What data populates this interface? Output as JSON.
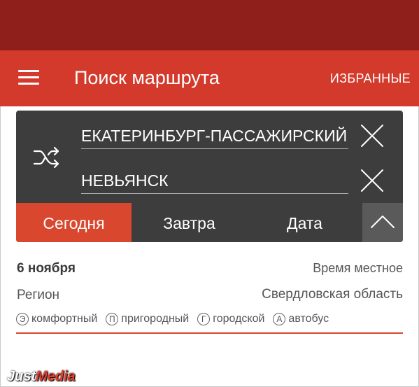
{
  "app_bar": {
    "title": "Поиск маршрута",
    "favorites_label": "ИЗБРАННЫЕ",
    "color": "#d33a2c",
    "status_color": "#8e1f1a"
  },
  "route": {
    "from": "ЕКАТЕРИНБУРГ-ПАССАЖИРСКИЙ",
    "to": "НЕВЬЯНСК"
  },
  "tabs": [
    {
      "label": "Сегодня",
      "selected": true
    },
    {
      "label": "Завтра",
      "selected": false
    },
    {
      "label": "Дата",
      "selected": false
    }
  ],
  "info": {
    "date": "6 ноября",
    "time_note": "Время местное",
    "region_label": "Регион",
    "region_value": "Свердловская область"
  },
  "legend": [
    {
      "badge": "Э",
      "label": "комфортный"
    },
    {
      "badge": "П",
      "label": "пригородный"
    },
    {
      "badge": "Г",
      "label": "городской"
    },
    {
      "badge": "А",
      "label": "автобус"
    }
  ],
  "watermark": {
    "part1": "Just",
    "part2": "Media"
  },
  "icons": [
    "menu-icon",
    "shuffle-icon",
    "close-icon",
    "chevron-up-icon"
  ]
}
